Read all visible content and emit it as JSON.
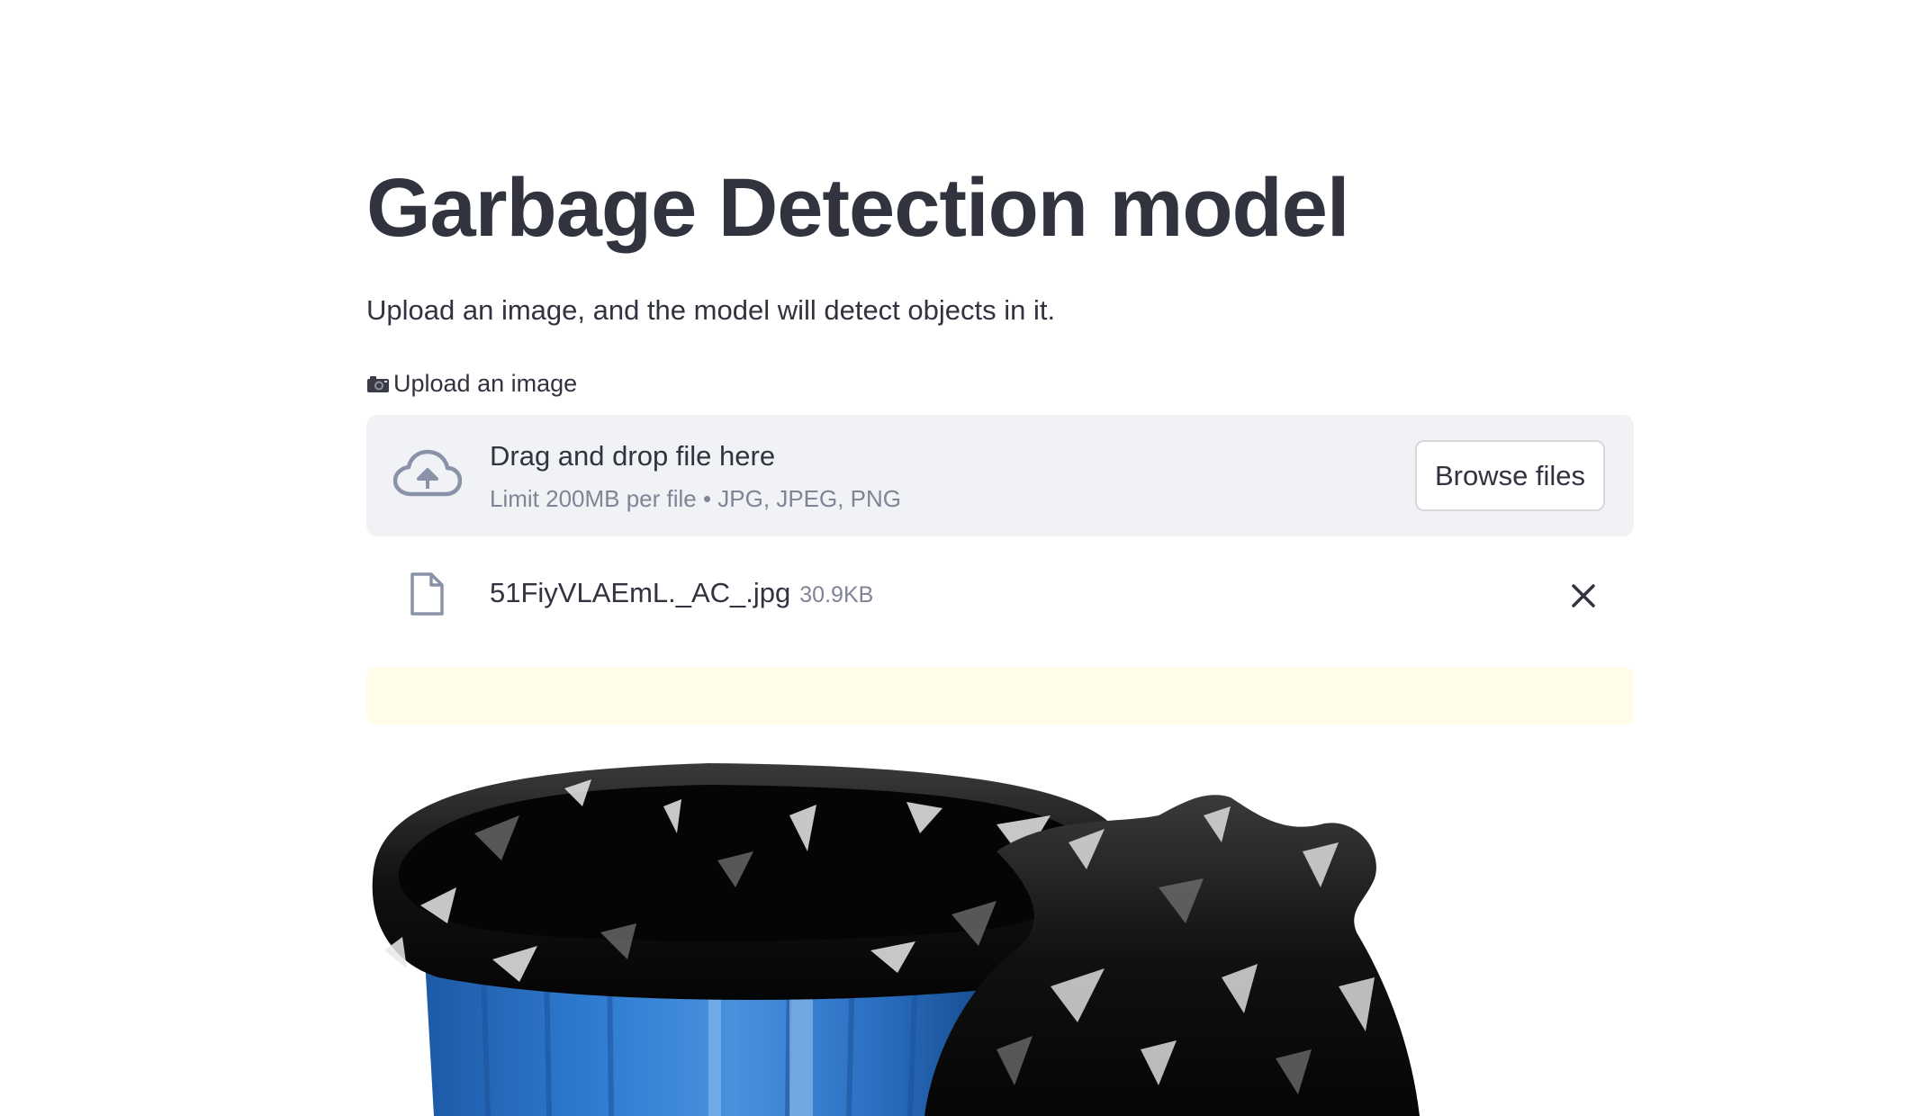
{
  "page": {
    "title": "Garbage Detection model",
    "subtitle": "Upload an image, and the model will detect objects in it."
  },
  "uploader": {
    "label": "Upload an image",
    "label_icon": "camera-icon",
    "dropzone_title": "Drag and drop file here",
    "dropzone_hint": "Limit 200MB per file • JPG, JPEG, PNG",
    "browse_label": "Browse files",
    "upload_icon": "cloud-upload-icon"
  },
  "uploaded_file": {
    "name": "51FiyVLAEmL._AC_.jpg",
    "size": "30.9KB",
    "icon": "file-icon",
    "remove_icon": "close-icon"
  },
  "colors": {
    "text": "#31333f",
    "muted": "#808495",
    "dropzone_bg": "#f0f2f6",
    "alert_bg": "#fffde9",
    "bin_blue": "#2f74c8"
  }
}
